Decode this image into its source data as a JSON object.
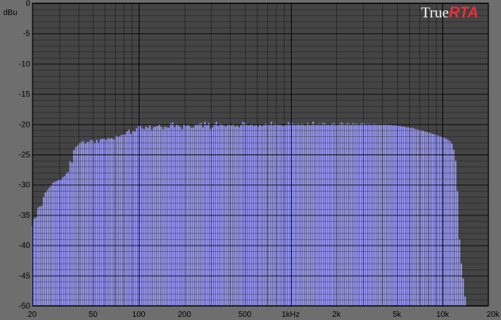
{
  "chart_data": {
    "type": "bar",
    "ylabel": "dBu",
    "ylim": [
      -50,
      0
    ],
    "xlim": [
      20,
      20000
    ],
    "xscale": "log",
    "grid": true,
    "y_ticks": [
      0,
      -5,
      -10,
      -15,
      -20,
      -25,
      -30,
      -35,
      -40,
      -45,
      -50
    ],
    "x_ticks": [
      {
        "value": 20,
        "label": "20"
      },
      {
        "value": 50,
        "label": "50"
      },
      {
        "value": 100,
        "label": "100"
      },
      {
        "value": 200,
        "label": "200"
      },
      {
        "value": 500,
        "label": "500"
      },
      {
        "value": 1000,
        "label": "1kHz"
      },
      {
        "value": 2000,
        "label": "2k"
      },
      {
        "value": 5000,
        "label": "5k"
      },
      {
        "value": 10000,
        "label": "10k"
      },
      {
        "value": 20000,
        "label": "20k"
      }
    ],
    "x": [
      20,
      20.6,
      21.2,
      21.8,
      22.4,
      23.1,
      23.7,
      24.4,
      25.2,
      25.9,
      26.6,
      27.4,
      28.2,
      29.0,
      29.9,
      30.8,
      31.7,
      32.6,
      33.5,
      34.5,
      35.5,
      36.5,
      37.6,
      38.7,
      39.8,
      41.0,
      42.2,
      43.4,
      44.7,
      46.0,
      47.3,
      48.7,
      50.1,
      51.6,
      53.1,
      54.6,
      56.2,
      57.9,
      59.6,
      61.3,
      63.1,
      64.9,
      66.8,
      68.8,
      70.8,
      72.8,
      75.0,
      77.2,
      79.4,
      81.7,
      84.1,
      86.6,
      89.1,
      91.7,
      94.4,
      97.2,
      100,
      102.9,
      105.9,
      109.0,
      112.2,
      115.5,
      118.9,
      122.3,
      125.9,
      129.6,
      133.4,
      137.3,
      141.3,
      145.4,
      149.6,
      154.0,
      158.5,
      163.1,
      167.9,
      172.8,
      177.8,
      183.0,
      188.4,
      193.9,
      199.5,
      205.4,
      211.3,
      217.5,
      223.9,
      230.4,
      237.1,
      244.1,
      251.2,
      258.5,
      266.1,
      273.8,
      281.8,
      290.1,
      298.5,
      307.3,
      316.2,
      325.5,
      335.0,
      344.7,
      354.8,
      365.2,
      375.8,
      386.8,
      398.1,
      409.7,
      421.7,
      434.0,
      446.7,
      459.7,
      473.2,
      487.0,
      501.2,
      515.8,
      530.9,
      546.4,
      562.3,
      578.7,
      595.7,
      613.1,
      631.0,
      649.4,
      668.3,
      687.9,
      707.9,
      728.6,
      749.9,
      771.8,
      794.3,
      817.5,
      841.4,
      866.0,
      891.3,
      917.3,
      944.1,
      971.6,
      1000,
      1029,
      1059,
      1090,
      1122,
      1155,
      1189,
      1223,
      1259,
      1296,
      1334,
      1373,
      1413,
      1454,
      1496,
      1540,
      1585,
      1631,
      1679,
      1728,
      1778,
      1830,
      1884,
      1939,
      1995,
      2054,
      2113,
      2175,
      2239,
      2304,
      2371,
      2441,
      2512,
      2585,
      2661,
      2738,
      2818,
      2901,
      2985,
      3073,
      3162,
      3255,
      3350,
      3447,
      3548,
      3652,
      3758,
      3868,
      3981,
      4097,
      4217,
      4340,
      4467,
      4597,
      4732,
      4870,
      5012,
      5158,
      5309,
      5464,
      5623,
      5787,
      5957,
      6131,
      6310,
      6494,
      6683,
      6879,
      7079,
      7286,
      7499,
      7718,
      7943,
      8175,
      8414,
      8660,
      8913,
      9173,
      9441,
      9716,
      10000,
      10290,
      10590,
      10900,
      11220,
      11550,
      11890,
      12230,
      12590,
      12960,
      13340,
      13730,
      14130,
      14540,
      14960,
      15400,
      15850,
      16310,
      16790,
      17280,
      17780,
      18300,
      18840,
      19390
    ],
    "values": [
      -36.8,
      -35.6,
      -35.4,
      -33.8,
      -33.6,
      -33.5,
      -32.0,
      -31.3,
      -30.9,
      -30.5,
      -30.1,
      -29.7,
      -29.5,
      -29.4,
      -29.2,
      -29.2,
      -28.8,
      -28.6,
      -28.1,
      -27.9,
      -26.1,
      -26.4,
      -24.3,
      -23.8,
      -23.5,
      -23.1,
      -22.9,
      -22.8,
      -23.2,
      -22.9,
      -22.9,
      -22.6,
      -22.7,
      -23.1,
      -22.6,
      -23.0,
      -22.5,
      -22.4,
      -22.4,
      -22.6,
      -22.3,
      -22.4,
      -22.3,
      -22.5,
      -21.9,
      -22.0,
      -22.0,
      -21.8,
      -21.7,
      -21.7,
      -21.2,
      -20.9,
      -21.6,
      -21.1,
      -21.2,
      -20.7,
      -20.3,
      -20.3,
      -20.7,
      -20.8,
      -20.4,
      -20.6,
      -20.2,
      -20.9,
      -20.5,
      -20.4,
      -20.3,
      -20.0,
      -20.4,
      -20.8,
      -20.4,
      -20.5,
      -20.6,
      -19.9,
      -19.7,
      -20.5,
      -20.0,
      -20.2,
      -20.4,
      -20.8,
      -20.0,
      -20.3,
      -20.1,
      -20.3,
      -20.6,
      -20.5,
      -20.0,
      -20.1,
      -19.9,
      -19.8,
      -20.5,
      -19.6,
      -20.2,
      -19.8,
      -20.8,
      -20.5,
      -20.0,
      -19.6,
      -20.3,
      -19.9,
      -20.1,
      -20.2,
      -20.4,
      -20.1,
      -20.1,
      -20.2,
      -20.0,
      -20.4,
      -20.2,
      -20.5,
      -20.1,
      -19.6,
      -19.8,
      -20.1,
      -20.2,
      -20.1,
      -20.0,
      -20.3,
      -20.1,
      -20.4,
      -20.0,
      -20.3,
      -20.0,
      -19.9,
      -20.0,
      -20.1,
      -19.6,
      -20.2,
      -19.9,
      -20.0,
      -20.1,
      -20.1,
      -20.3,
      -20.2,
      -20.1,
      -19.7,
      -20.1,
      -19.8,
      -20.0,
      -20.0,
      -19.9,
      -20.1,
      -19.9,
      -20.0,
      -20.2,
      -19.8,
      -20.1,
      -20.0,
      -19.6,
      -20.0,
      -20.1,
      -19.9,
      -20.0,
      -19.8,
      -19.8,
      -20.0,
      -20.1,
      -20.0,
      -19.9,
      -19.8,
      -20.0,
      -20.1,
      -19.9,
      -19.7,
      -19.9,
      -20.0,
      -19.8,
      -19.9,
      -20.0,
      -19.8,
      -19.9,
      -19.9,
      -20.0,
      -19.9,
      -19.8,
      -19.9,
      -20.0,
      -19.9,
      -20.0,
      -20.0,
      -19.9,
      -20.0,
      -20.0,
      -20.1,
      -20.0,
      -20.0,
      -20.1,
      -20.0,
      -20.1,
      -20.1,
      -20.2,
      -20.2,
      -20.2,
      -20.3,
      -20.3,
      -20.4,
      -20.4,
      -20.5,
      -20.5,
      -20.6,
      -20.6,
      -20.7,
      -20.8,
      -20.9,
      -20.9,
      -21.0,
      -21.1,
      -21.2,
      -21.3,
      -21.4,
      -21.5,
      -21.6,
      -21.7,
      -21.8,
      -21.9,
      -22.0,
      -22.1,
      -22.2,
      -22.4,
      -22.6,
      -22.8,
      -23.2,
      -24.2,
      -26.0,
      -31.0,
      -39.0,
      -43.0,
      -45.5,
      -48.5
    ],
    "bar_color": "#9999ff",
    "plot_bg": "#444444",
    "grid_color": "#000000"
  },
  "logo": {
    "part1": "True",
    "part2": "RTA",
    "part1_color": "#f2f2f2",
    "part2_color": "#e8303a"
  }
}
